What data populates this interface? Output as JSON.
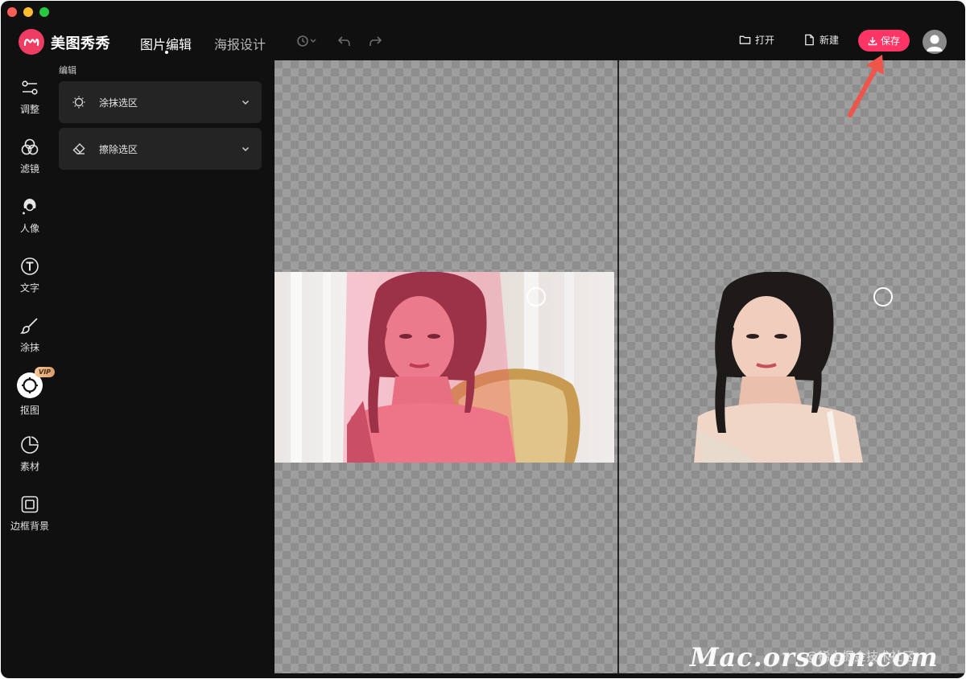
{
  "app": {
    "title": "美图秀秀",
    "logo_icon": "meitu-logo-icon",
    "brand_color": "#ee3c63"
  },
  "header": {
    "tabs": [
      {
        "label": "图片编辑",
        "active": true
      },
      {
        "label": "海报设计",
        "active": false
      }
    ],
    "history_icons": [
      "history-icon",
      "undo-icon",
      "redo-icon"
    ],
    "open_label": "打开",
    "new_label": "新建",
    "save_label": "保存",
    "save_color": "#ff3566"
  },
  "sidebar": {
    "items": [
      {
        "label": "调整",
        "icon": "sliders-icon"
      },
      {
        "label": "滤镜",
        "icon": "filter-circles-icon"
      },
      {
        "label": "人像",
        "icon": "portrait-icon"
      },
      {
        "label": "文字",
        "icon": "text-icon"
      },
      {
        "label": "涂抹",
        "icon": "brush-icon"
      },
      {
        "label": "抠图",
        "icon": "cutout-icon",
        "active": true,
        "badge": "VIP"
      },
      {
        "label": "素材",
        "icon": "sticker-icon"
      },
      {
        "label": "边框背景",
        "icon": "frame-icon"
      }
    ]
  },
  "panel": {
    "heading": "编辑",
    "rows": [
      {
        "label": "涂抹选区",
        "icon": "brush-select-icon"
      },
      {
        "label": "擦除选区",
        "icon": "eraser-icon"
      }
    ]
  },
  "watermark": {
    "site": "Mac.orsoon.com",
    "community": "@稀土掘金技术社区"
  }
}
